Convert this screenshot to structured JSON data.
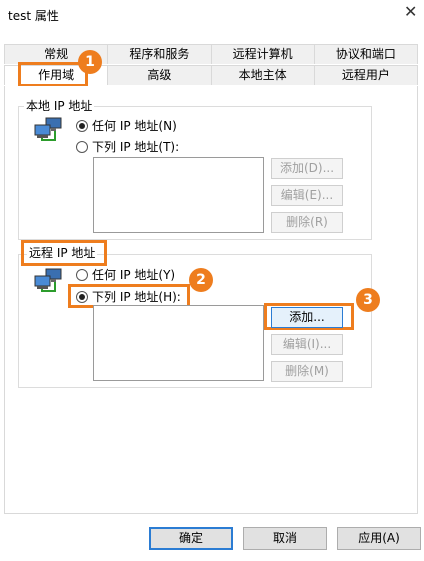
{
  "window": {
    "title": "test 属性"
  },
  "tabs_row1": [
    "常规",
    "程序和服务",
    "远程计算机",
    "协议和端口"
  ],
  "tabs_row2": [
    "作用域",
    "高级",
    "本地主体",
    "远程用户"
  ],
  "local": {
    "label": "本地 IP 地址",
    "any": "任何 IP 地址(N)",
    "list": "下列 IP 地址(T):",
    "add": "添加(D)...",
    "edit": "编辑(E)...",
    "remove": "删除(R)"
  },
  "remote": {
    "label": "远程 IP 地址",
    "any": "任何 IP 地址(Y)",
    "list": "下列 IP 地址(H):",
    "add": "添加...",
    "edit": "编辑(I)...",
    "remove": "删除(M)"
  },
  "footer": {
    "ok": "确定",
    "cancel": "取消",
    "apply": "应用(A)"
  },
  "badges": [
    "1",
    "2",
    "3"
  ],
  "colors": {
    "highlight": "#ee7d1e",
    "focus": "#2b7cd3"
  }
}
